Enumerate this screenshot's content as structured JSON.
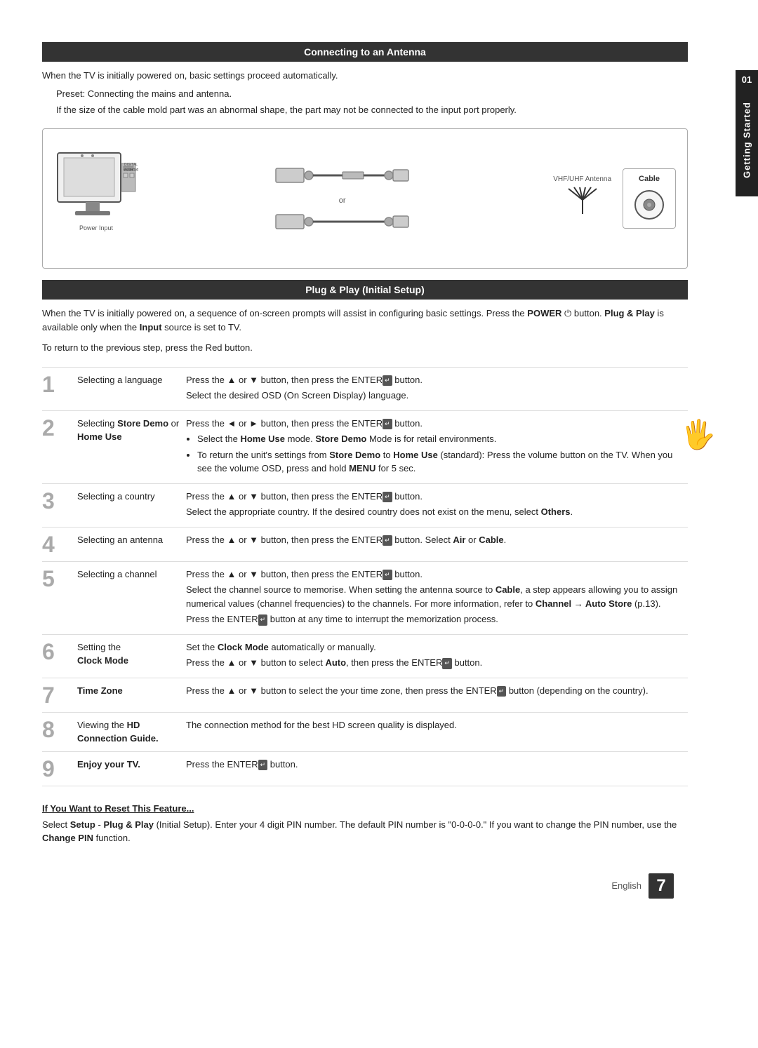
{
  "side_tab": {
    "number": "01",
    "label": "Getting Started"
  },
  "section1": {
    "title": "Connecting to an Antenna"
  },
  "section2": {
    "title": "Plug & Play (Initial Setup)"
  },
  "intro1": "When the TV is initially powered on, basic settings proceed automatically.",
  "preset_text": "Preset: Connecting the mains and antenna.",
  "cable_note": "If the size of the cable mold part was an abnormal shape, the part may not be connected to the input port properly.",
  "diagram": {
    "vhf_label": "VHF/UHF Antenna",
    "cable_label": "Cable",
    "power_label": "Power Input",
    "or_text": "or"
  },
  "plug_play_intro": "When the TV is initially powered on, a sequence of on-screen prompts will assist in configuring basic settings. Press the POWER  button. Plug & Play is available only when the Input source is set to TV.",
  "plug_play_sub": "To return to the previous step, press the Red button.",
  "steps": [
    {
      "number": "1",
      "left": "Selecting a language",
      "right_lines": [
        "Press the ▲ or ▼ button, then press the ENTER  button.",
        "Select the desired OSD (On Screen Display) language."
      ],
      "bullets": []
    },
    {
      "number": "2",
      "left_main": "Selecting ",
      "left_bold": "Store Demo",
      "left_rest": " or ",
      "left_bold2": "Home Use",
      "right_lines": [
        "Press the ◄ or ► button, then press the ENTER  button."
      ],
      "bullets": [
        "Select the Home Use mode. Store Demo Mode is for retail environments.",
        "To return the unit's settings from Store Demo to Home Use (standard): Press the volume button on the TV. When you see the volume OSD, press and hold MENU for 5 sec."
      ]
    },
    {
      "number": "3",
      "left": "Selecting a country",
      "right_lines": [
        "Press the ▲ or ▼ button, then press the ENTER  button.",
        "Select the appropriate country. If the desired country does not exist on the menu, select Others."
      ],
      "bullets": []
    },
    {
      "number": "4",
      "left": "Selecting an antenna",
      "right_lines": [
        "Press the ▲ or ▼ button, then press the ENTER  button. Select Air or Cable."
      ],
      "bullets": []
    },
    {
      "number": "5",
      "left": "Selecting a channel",
      "right_lines": [
        "Press the ▲ or ▼ button, then press the ENTER  button.",
        "Select the channel source to memorise. When setting the antenna source to Cable, a step appears allowing you to assign numerical values (channel frequencies) to the channels. For more information, refer to Channel → Auto Store (p.13).",
        "Press the ENTER  button at any time to interrupt the memorization process."
      ],
      "bullets": []
    },
    {
      "number": "6",
      "left_main": "Setting the ",
      "left_bold": "Clock Mode",
      "right_lines": [
        "Set the Clock Mode automatically or manually.",
        "Press the ▲ or ▼ button to select Auto, then press the ENTER  button."
      ],
      "bullets": []
    },
    {
      "number": "7",
      "left_bold": "Time Zone",
      "right_lines": [
        "Press the ▲ or ▼ button to select the your time zone, then press the ENTER  button (depending on the country)."
      ],
      "bullets": []
    },
    {
      "number": "8",
      "left_main": "Viewing the ",
      "left_bold": "HD Connection Guide.",
      "right_lines": [
        "The connection method for the best HD screen quality is displayed."
      ],
      "bullets": []
    },
    {
      "number": "9",
      "left_bold": "Enjoy your TV.",
      "right_lines": [
        "Press the ENTER  button."
      ],
      "bullets": []
    }
  ],
  "if_you_want": {
    "title": "If You Want to Reset This Feature...",
    "text": "Select Setup - Plug & Play (Initial Setup). Enter your 4 digit PIN number. The default PIN number is \"0-0-0-0.\" If you want to change the PIN number, use the Change PIN function."
  },
  "footer": {
    "lang": "English",
    "page": "7"
  }
}
